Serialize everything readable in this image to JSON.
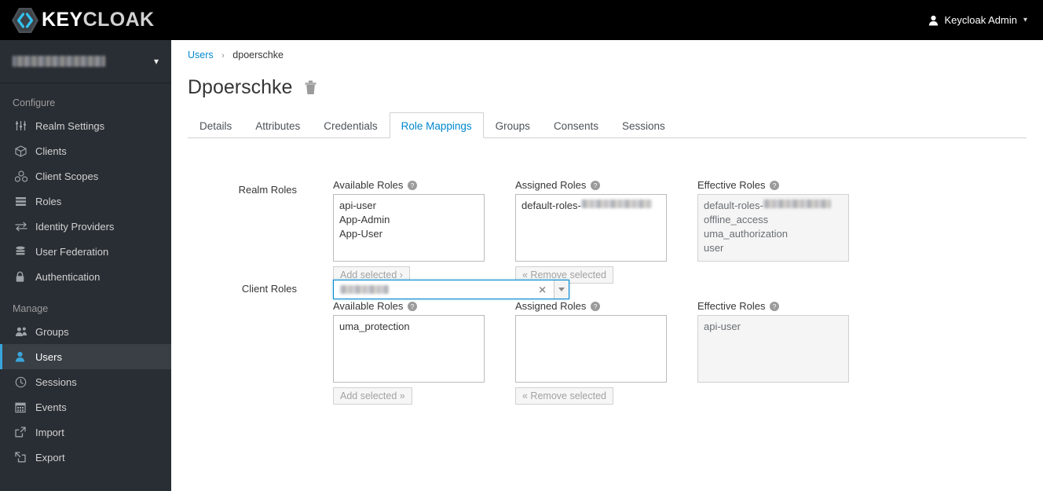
{
  "masthead": {
    "brand_key": "KEY",
    "brand_cloak": "CLOAK",
    "logo_icon": "keycloak-hexagon-logo",
    "user_icon": "person-icon",
    "user_label": "Keycloak Admin",
    "user_caret_icon": "chevron-down-icon"
  },
  "sidebar": {
    "realm": {
      "name": "",
      "redacted": true,
      "caret_icon": "chevron-down-icon"
    },
    "groups": [
      {
        "title": "Configure",
        "items": [
          {
            "label": "Realm Settings",
            "icon": "sliders-icon",
            "active": false
          },
          {
            "label": "Clients",
            "icon": "cube-icon",
            "active": false
          },
          {
            "label": "Client Scopes",
            "icon": "cubes-icon",
            "active": false
          },
          {
            "label": "Roles",
            "icon": "list-bars-icon",
            "active": false
          },
          {
            "label": "Identity Providers",
            "icon": "exchange-arrows-icon",
            "active": false
          },
          {
            "label": "User Federation",
            "icon": "database-icon",
            "active": false
          },
          {
            "label": "Authentication",
            "icon": "lock-icon",
            "active": false
          }
        ]
      },
      {
        "title": "Manage",
        "items": [
          {
            "label": "Groups",
            "icon": "users-icon",
            "active": false
          },
          {
            "label": "Users",
            "icon": "user-icon",
            "active": true
          },
          {
            "label": "Sessions",
            "icon": "clock-icon",
            "active": false
          },
          {
            "label": "Events",
            "icon": "calendar-icon",
            "active": false
          },
          {
            "label": "Import",
            "icon": "import-arrow-icon",
            "active": false
          },
          {
            "label": "Export",
            "icon": "export-arrow-icon",
            "active": false
          }
        ]
      }
    ]
  },
  "breadcrumb": {
    "root": "Users",
    "separator": "›",
    "current": "dpoerschke"
  },
  "page": {
    "title": "Dpoerschke",
    "delete_icon": "trash-icon"
  },
  "tabs": [
    {
      "label": "Details",
      "active": false
    },
    {
      "label": "Attributes",
      "active": false
    },
    {
      "label": "Credentials",
      "active": false
    },
    {
      "label": "Role Mappings",
      "active": true
    },
    {
      "label": "Groups",
      "active": false
    },
    {
      "label": "Consents",
      "active": false
    },
    {
      "label": "Sessions",
      "active": false
    }
  ],
  "realm_roles": {
    "row_label": "Realm Roles",
    "available": {
      "label": "Available Roles",
      "help_icon": "help-circle-icon",
      "options": [
        "api-user",
        "App-Admin",
        "App-User"
      ],
      "button": "Add selected ›"
    },
    "assigned": {
      "label": "Assigned Roles",
      "help_icon": "help-circle-icon",
      "options": [
        "default-roles-"
      ],
      "option_redacted": true,
      "button": "« Remove selected"
    },
    "effective": {
      "label": "Effective Roles",
      "help_icon": "help-circle-icon",
      "options": [
        "default-roles-",
        "offline_access",
        "uma_authorization",
        "user"
      ],
      "first_option_redacted": true
    }
  },
  "client_roles": {
    "row_label": "Client Roles",
    "select": {
      "value": "",
      "redacted": true,
      "clear_icon": "close-x-icon",
      "dropdown_icon": "caret-down-icon"
    },
    "available": {
      "label": "Available Roles",
      "help_icon": "help-circle-icon",
      "options": [
        "uma_protection"
      ],
      "button": "Add selected »"
    },
    "assigned": {
      "label": "Assigned Roles",
      "help_icon": "help-circle-icon",
      "options": [],
      "button": "« Remove selected"
    },
    "effective": {
      "label": "Effective Roles",
      "help_icon": "help-circle-icon",
      "options": [
        "api-user"
      ]
    }
  },
  "colors": {
    "masthead_bg": "#000000",
    "sidebar_bg": "#292e34",
    "accent_blue": "#0088ce",
    "active_nav_blue": "#39a5dc",
    "logo_blue": "#33c3f0"
  }
}
